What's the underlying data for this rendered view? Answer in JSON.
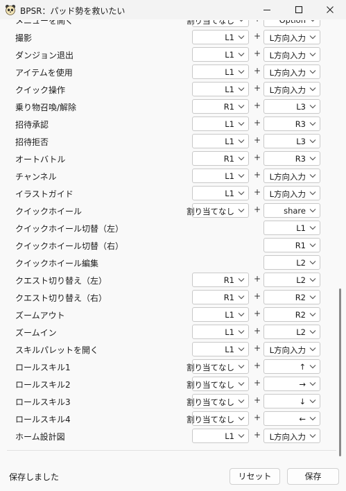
{
  "window": {
    "title": "BPSR：パッド勢を救いたい",
    "icon": "panda-face-icon",
    "controls": [
      "minimize-icon",
      "maximize-icon",
      "close-icon"
    ]
  },
  "separator": "+",
  "rows": [
    {
      "label": "メニューを開く",
      "c1": "割り当てなし",
      "c2": "Option"
    },
    {
      "label": "撮影",
      "c1": "L1",
      "c2": "L方向入力"
    },
    {
      "label": "ダンジョン退出",
      "c1": "L1",
      "c2": "L方向入力"
    },
    {
      "label": "アイテムを使用",
      "c1": "L1",
      "c2": "L方向入力"
    },
    {
      "label": "クイック操作",
      "c1": "L1",
      "c2": "L方向入力"
    },
    {
      "label": "乗り物召喚/解除",
      "c1": "R1",
      "c2": "L3"
    },
    {
      "label": "招待承認",
      "c1": "L1",
      "c2": "R3"
    },
    {
      "label": "招待拒否",
      "c1": "L1",
      "c2": "L3"
    },
    {
      "label": "オートバトル",
      "c1": "R1",
      "c2": "R3"
    },
    {
      "label": "チャンネル",
      "c1": "L1",
      "c2": "L方向入力"
    },
    {
      "label": "イラストガイド",
      "c1": "L1",
      "c2": "L方向入力"
    },
    {
      "label": "クイックホイール",
      "c1": "割り当てなし",
      "c2": "share"
    },
    {
      "label": "クイックホイール切替（左）",
      "c1": null,
      "c2": "L1"
    },
    {
      "label": "クイックホイール切替（右）",
      "c1": null,
      "c2": "R1"
    },
    {
      "label": "クイックホイール編集",
      "c1": null,
      "c2": "L2"
    },
    {
      "label": "クエスト切り替え（左）",
      "c1": "R1",
      "c2": "L2"
    },
    {
      "label": "クエスト切り替え（右）",
      "c1": "R1",
      "c2": "R2"
    },
    {
      "label": "ズームアウト",
      "c1": "L1",
      "c2": "R2"
    },
    {
      "label": "ズームイン",
      "c1": "L1",
      "c2": "L2"
    },
    {
      "label": "スキルパレットを開く",
      "c1": "L1",
      "c2": "L方向入力"
    },
    {
      "label": "ロールスキル1",
      "c1": "割り当てなし",
      "c2": "↑"
    },
    {
      "label": "ロールスキル2",
      "c1": "割り当てなし",
      "c2": "→"
    },
    {
      "label": "ロールスキル3",
      "c1": "割り当てなし",
      "c2": "↓"
    },
    {
      "label": "ロールスキル4",
      "c1": "割り当てなし",
      "c2": "←"
    },
    {
      "label": "ホーム設計図",
      "c1": "L1",
      "c2": "L方向入力"
    }
  ],
  "status": "保存しました",
  "buttons": {
    "reset": "リセット",
    "save": "保存"
  },
  "scroll_position": 0.95
}
